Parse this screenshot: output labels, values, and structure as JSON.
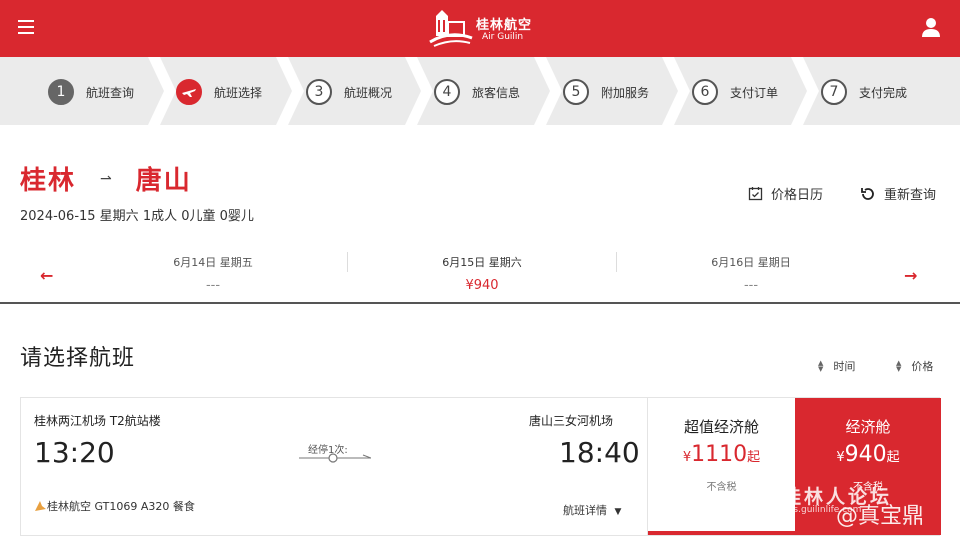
{
  "header": {
    "logo_cn": "桂林航空",
    "logo_en": "Air Guilin",
    "brand_color": "#d9282f",
    "menu_icon": "hamburger-menu-icon",
    "user_icon": "user-icon"
  },
  "steps": [
    {
      "num": "1",
      "label": "航班查询",
      "state": "done"
    },
    {
      "num": "",
      "label": "航班选择",
      "state": "active",
      "icon": "airplane-icon"
    },
    {
      "num": "3",
      "label": "航班概况",
      "state": "todo"
    },
    {
      "num": "4",
      "label": "旅客信息",
      "state": "todo"
    },
    {
      "num": "5",
      "label": "附加服务",
      "state": "todo"
    },
    {
      "num": "6",
      "label": "支付订单",
      "state": "todo"
    },
    {
      "num": "7",
      "label": "支付完成",
      "state": "todo"
    }
  ],
  "route": {
    "from": "桂林",
    "to": "唐山",
    "info": "2024-06-15 星期六 1成人 0儿童 0婴儿"
  },
  "tools": {
    "calendar": "价格日历",
    "research": "重新查询"
  },
  "dates": [
    {
      "date": "6月14日 星期五",
      "price": "---"
    },
    {
      "date": "6月15日 星期六",
      "price": "¥940"
    },
    {
      "date": "6月16日 星期日",
      "price": "---"
    }
  ],
  "list": {
    "title": "请选择航班",
    "sort_time": "时间",
    "sort_price": "价格"
  },
  "flight": {
    "dep_airport": "桂林两江机场  T2航站楼",
    "dep_time": "13:20",
    "arr_airport": "唐山三女河机场",
    "arr_time": "18:40",
    "stops": "经停1次:",
    "airline_info": "桂林航空 GT1069 A320 餐食",
    "details": "航班详情",
    "fares": [
      {
        "name": "超值经济舱",
        "currency": "¥",
        "amount": "1110",
        "suffix": "起",
        "tax": "不含税"
      },
      {
        "name": "经济舱",
        "currency": "¥",
        "amount": "940",
        "suffix": "起",
        "tax": "不含税"
      }
    ]
  },
  "watermark": {
    "text": "桂林人论坛",
    "sub": "bbs.guilinlife.com",
    "author": "@真宝鼎"
  }
}
